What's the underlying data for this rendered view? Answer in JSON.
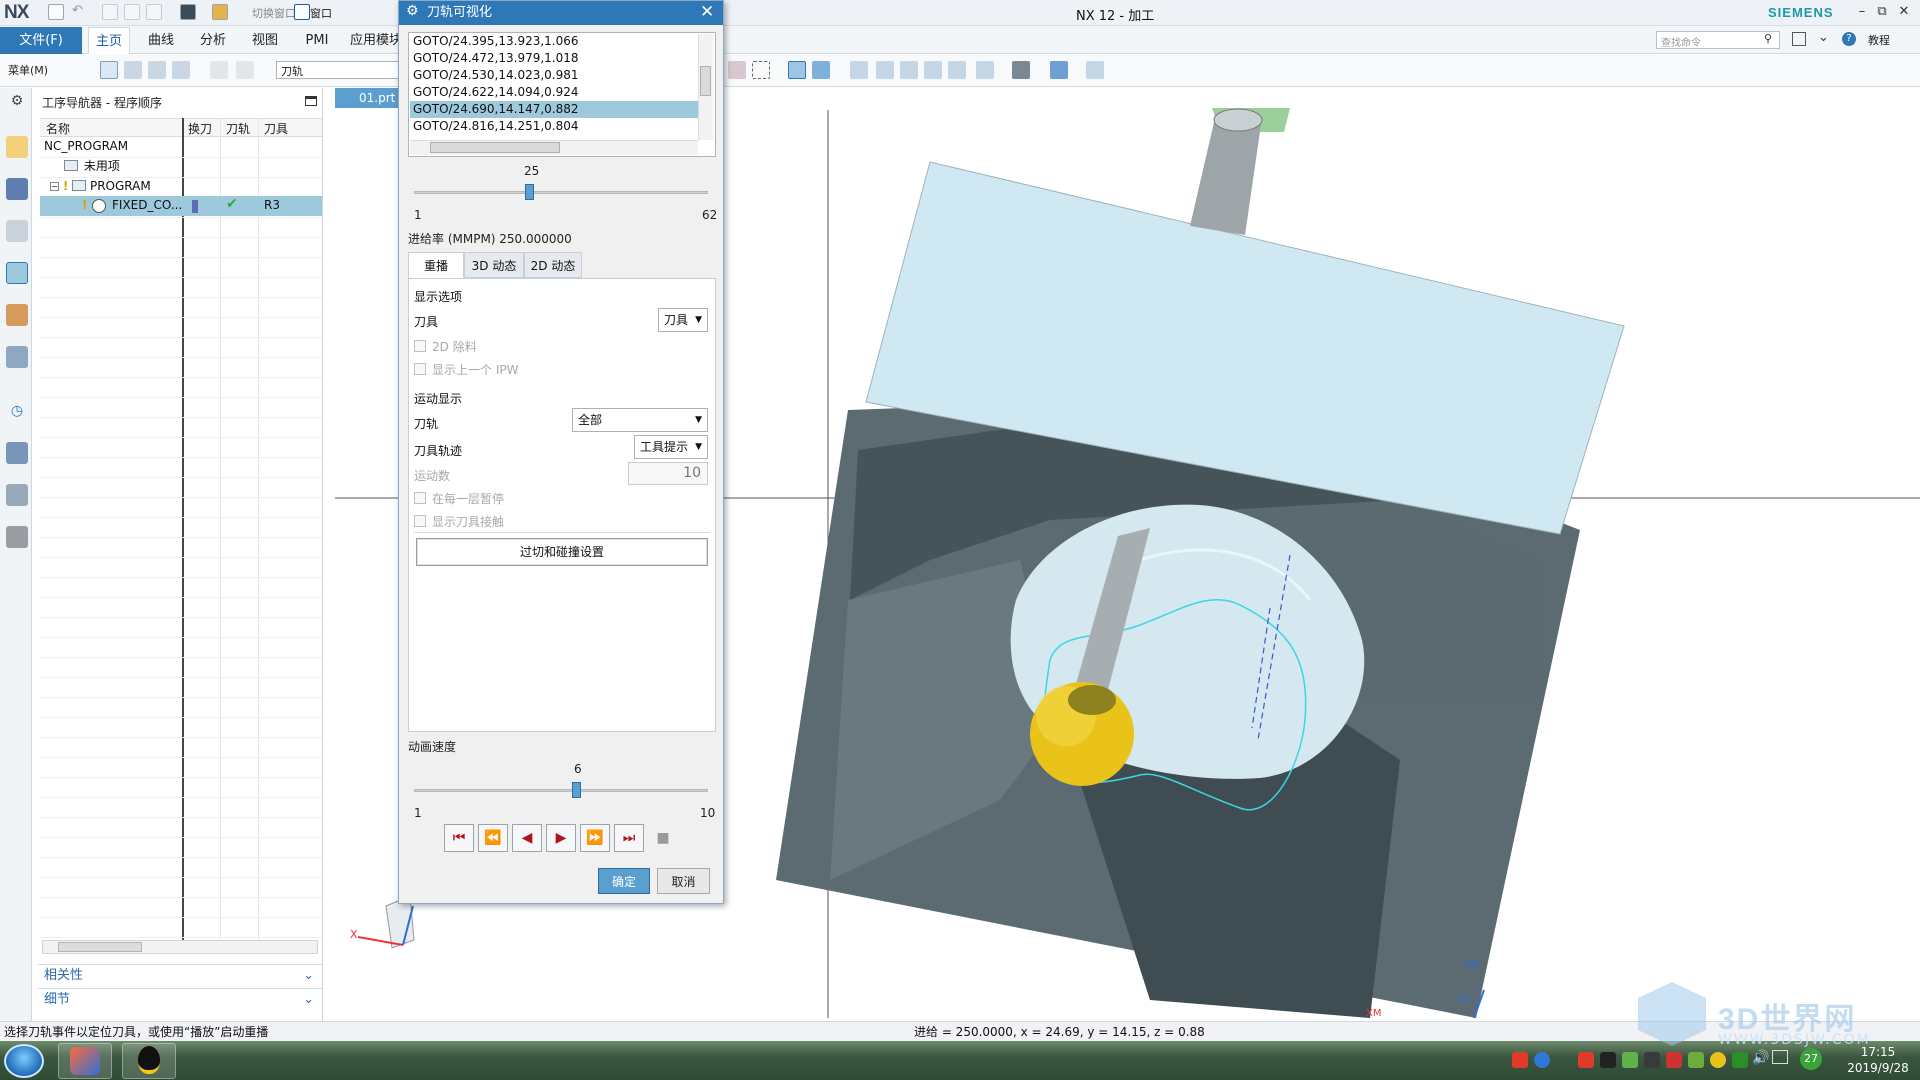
{
  "window": {
    "logo": "NX",
    "title": "NX 12 - 加工",
    "brand": "SIEMENS",
    "quick_access": {
      "switch_window": "切换窗口",
      "window": "窗口"
    },
    "controls": {
      "min": "–",
      "restore": "⧉",
      "close": "✕"
    }
  },
  "ribbon": {
    "file_tab": "文件(F)",
    "tabs": [
      "主页",
      "曲线",
      "分析",
      "视图",
      "PMI",
      "应用模块"
    ],
    "active_tab": "主页",
    "search_placeholder": "查找命令",
    "tutorial": "教程"
  },
  "toolbar": {
    "menu_label": "菜单(M)",
    "filter_value": "刀轨"
  },
  "navigator": {
    "title": "工序导航器 - 程序顺序",
    "columns": [
      "名称",
      "换刀",
      "刀轨",
      "刀具"
    ],
    "rows": [
      {
        "name": "NC_PROGRAM",
        "indent": 0,
        "tool": ""
      },
      {
        "name": "未用项",
        "indent": 1,
        "tool": ""
      },
      {
        "name": "PROGRAM",
        "indent": 1,
        "tool": ""
      },
      {
        "name": "FIXED_CO...",
        "indent": 2,
        "tool": "R3"
      }
    ],
    "accordion": [
      "相关性",
      "细节"
    ]
  },
  "part_tab": "01.prt",
  "dialog": {
    "title": "刀轨可视化",
    "goto_list": [
      "GOTO/24.395,13.923,1.066",
      "GOTO/24.472,13.979,1.018",
      "GOTO/24.530,14.023,0.981",
      "GOTO/24.622,14.094,0.924",
      "GOTO/24.690,14.147,0.882",
      "GOTO/24.816,14.251,0.804"
    ],
    "selected_goto_index": 4,
    "position_slider": {
      "value": "25",
      "min": "1",
      "max": "62",
      "fraction": 0.39
    },
    "feed_rate": "进给率 (MMPM) 250.000000",
    "tabs": [
      "重播",
      "3D 动态",
      "2D 动态"
    ],
    "active_tab": "重播",
    "display_options": "显示选项",
    "tool_label": "刀具",
    "tool_value": "刀具",
    "cb_2d_stock": "2D 除料",
    "cb_prev_ipw": "显示上一个 IPW",
    "motion_display": "运动显示",
    "toolpath_label": "刀轨",
    "toolpath_value": "全部",
    "tooltrace_label": "刀具轨迹",
    "tooltrace_value": "工具提示",
    "motion_count_label": "运动数",
    "motion_count_value": "10",
    "cb_pause_each_layer": "在每一层暂停",
    "cb_show_contact": "显示刀具接触",
    "collision_button": "过切和碰撞设置",
    "anim_speed_label": "动画速度",
    "speed_slider": {
      "value": "6",
      "min": "1",
      "max": "10",
      "fraction": 0.55
    },
    "ok": "确定",
    "cancel": "取消"
  },
  "status": {
    "message": "选择刀轨事件以定位刀具，或使用“播放”启动重播",
    "coords": "进给 = 250.0000, x = 24.69, y = 14.15, z = 0.88"
  },
  "viewport": {
    "triad_x": "X",
    "triad_zm": "ZM",
    "triad_zc": "ZC",
    "triad_xm": "XM"
  },
  "taskbar": {
    "time": "17:15",
    "date": "2019/9/28",
    "badge": "27"
  },
  "watermark": {
    "brand": "3D世界网",
    "url": "WWW.3DSJW.COM"
  },
  "colors": {
    "accent": "#2f78b8",
    "selection": "#9ec8dc",
    "toolpath": "#39d7e2",
    "ball_tool": "#e9c21a",
    "block_top": "#cfe8f2",
    "block_side": "#49575e"
  }
}
